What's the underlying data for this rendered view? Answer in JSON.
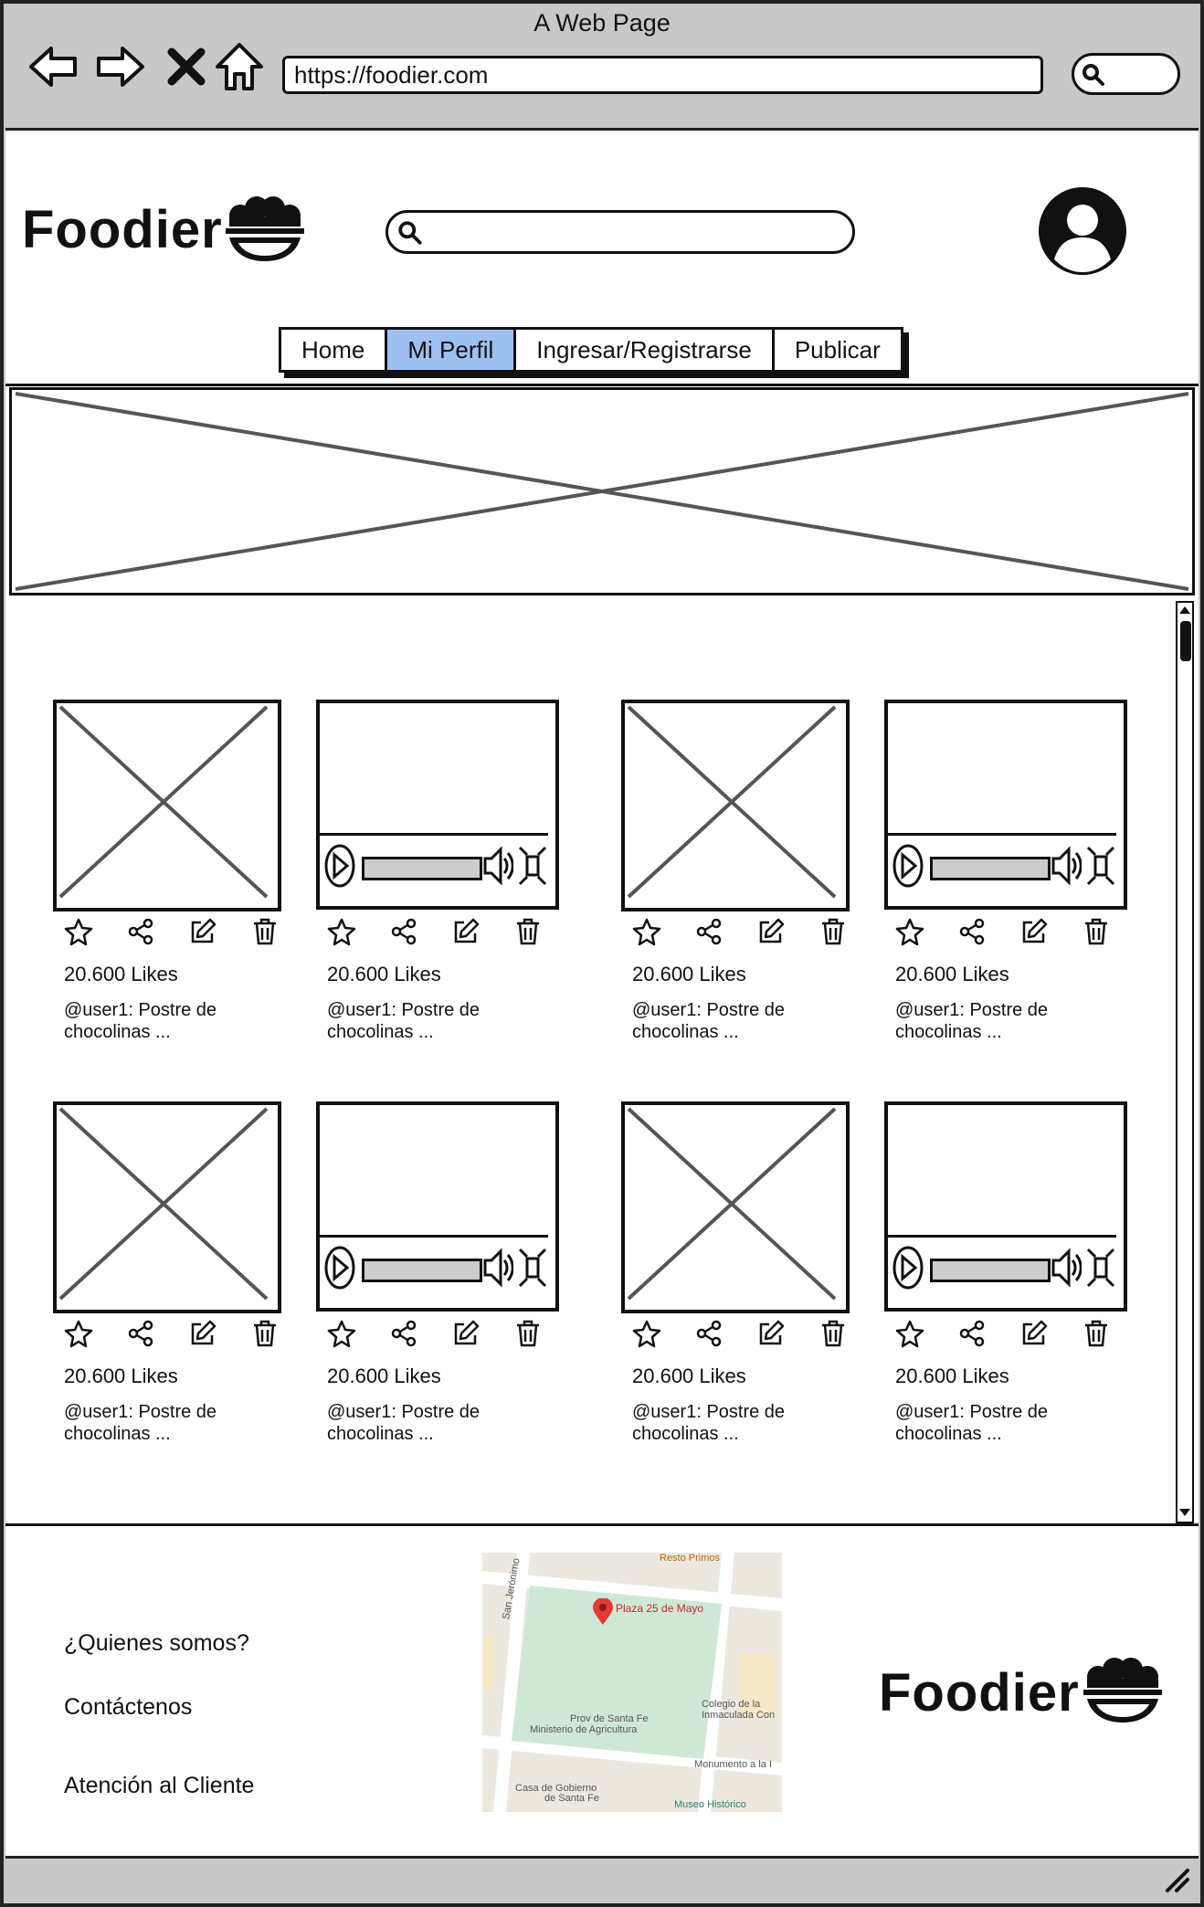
{
  "window": {
    "title": "A Web Page",
    "url": "https://foodier.com"
  },
  "header": {
    "logo_text": "Foodier",
    "logo_icon": "food-bowl-icon",
    "search_placeholder": "",
    "avatar_icon": "user-avatar-icon"
  },
  "nav": {
    "tabs": [
      {
        "label": "Home"
      },
      {
        "label": "Mi Perfil",
        "active": true
      },
      {
        "label": "Ingresar/Registrarse"
      },
      {
        "label": "Publicar"
      }
    ]
  },
  "feed": {
    "posts": [
      {
        "media": "image",
        "likes": "20.600 Likes",
        "caption_line1": "@user1: Postre de",
        "caption_line2": "chocolinas ..."
      },
      {
        "media": "video",
        "likes": "20.600 Likes",
        "caption_line1": "@user1: Postre de",
        "caption_line2": "chocolinas ..."
      },
      {
        "media": "image",
        "likes": "20.600 Likes",
        "caption_line1": "@user1: Postre de",
        "caption_line2": "chocolinas ..."
      },
      {
        "media": "video",
        "likes": "20.600 Likes",
        "caption_line1": "@user1: Postre de",
        "caption_line2": "chocolinas ..."
      },
      {
        "media": "image",
        "likes": "20.600 Likes",
        "caption_line1": "@user1: Postre de",
        "caption_line2": "chocolinas ..."
      },
      {
        "media": "video",
        "likes": "20.600 Likes",
        "caption_line1": "@user1: Postre de",
        "caption_line2": "chocolinas ..."
      },
      {
        "media": "image",
        "likes": "20.600 Likes",
        "caption_line1": "@user1: Postre de",
        "caption_line2": "chocolinas ..."
      },
      {
        "media": "video",
        "likes": "20.600 Likes",
        "caption_line1": "@user1: Postre de",
        "caption_line2": "chocolinas ..."
      }
    ]
  },
  "footer": {
    "links": [
      "¿Quienes somos?",
      "Contáctenos",
      "Atención al Cliente"
    ],
    "logo_text": "Foodier",
    "map": {
      "labels": {
        "plaza": "Plaza 25 de Mayo",
        "resto": "Resto Primos",
        "street": "San Jerónimo",
        "ministry1": "Prov de Santa Fe",
        "ministry2": "Ministerio de Agricultura",
        "colegio1": "Colegio de la",
        "colegio2": "Inmaculada Con",
        "monumento": "Monumento a la I",
        "casa1": "Casa de Gobierno",
        "casa2": "de Santa Fe",
        "museo": "Museo Histórico"
      }
    }
  },
  "colors": {
    "active_tab": "#9ec0f0",
    "chrome": "#c8c8c8",
    "map_park": "#cfe8d6",
    "map_pin": "#e53935"
  }
}
